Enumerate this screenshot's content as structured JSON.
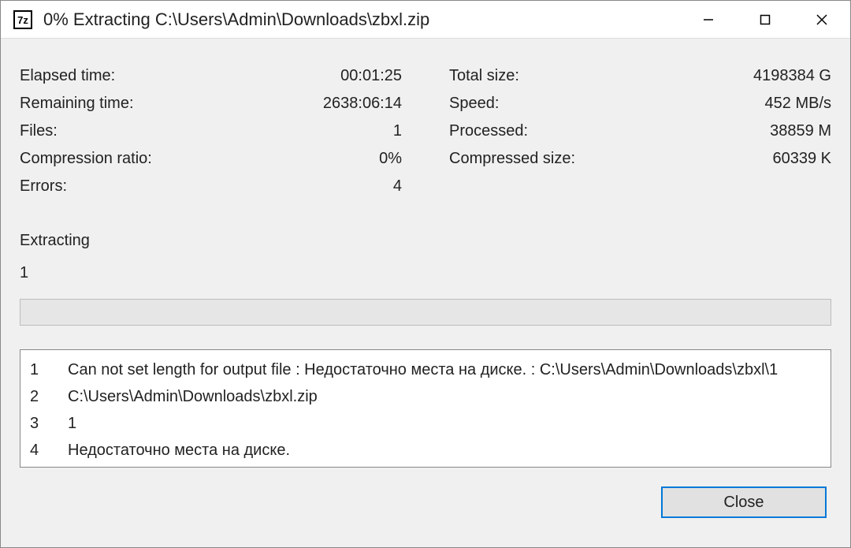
{
  "window": {
    "title": "0% Extracting C:\\Users\\Admin\\Downloads\\zbxl.zip"
  },
  "left": {
    "elapsed_label": "Elapsed time:",
    "elapsed_value": "00:01:25",
    "remaining_label": "Remaining time:",
    "remaining_value": "2638:06:14",
    "files_label": "Files:",
    "files_value": "1",
    "ratio_label": "Compression ratio:",
    "ratio_value": "0%",
    "errors_label": "Errors:",
    "errors_value": "4"
  },
  "right": {
    "total_label": "Total size:",
    "total_value": "4198384 G",
    "speed_label": "Speed:",
    "speed_value": "452 MB/s",
    "processed_label": "Processed:",
    "processed_value": "38859 M",
    "compressed_label": "Compressed size:",
    "compressed_value": "60339 K"
  },
  "status": "Extracting",
  "current_file": "1",
  "errors": {
    "n1": "1",
    "t1": "Can not set length for output file : Недостаточно места на диске. : C:\\Users\\Admin\\Downloads\\zbxl\\1",
    "n2": "2",
    "t2": "C:\\Users\\Admin\\Downloads\\zbxl.zip",
    "n3": "3",
    "t3": "1",
    "n4": "4",
    "t4": "Недостаточно места на диске."
  },
  "footer": {
    "close_label": "Close"
  }
}
